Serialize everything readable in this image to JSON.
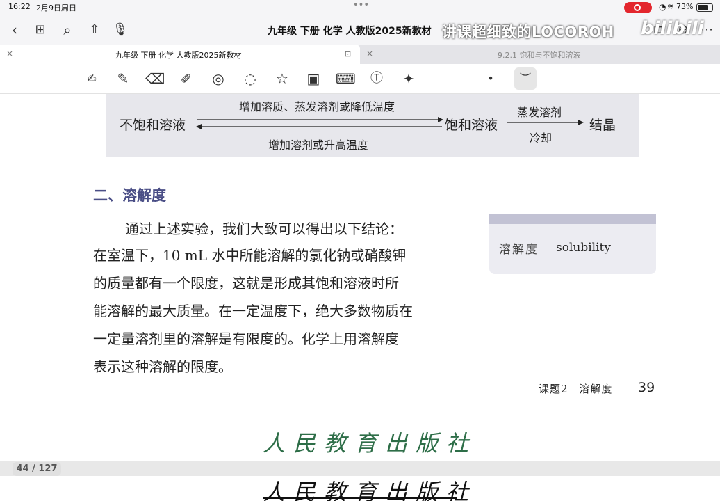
{
  "status_bar": {
    "time": "16:22",
    "date": "2月9日周日",
    "battery": "73%",
    "battery_level": 0.73
  },
  "nav": {
    "document_title": "九年级 下册 化学 人教版2025新教材"
  },
  "overlay": {
    "watermark": "讲课超细致的LOCOROH",
    "logo": "bilibili"
  },
  "tabs": [
    {
      "label": "九年级 下册 化学 人教版2025新教材",
      "active": true
    },
    {
      "label": "9.2.1 饱和与不饱和溶液",
      "active": false
    }
  ],
  "toolbar": {
    "tools": [
      "lasso-ocr",
      "pen",
      "eraser",
      "highlighter",
      "shapes",
      "lasso",
      "sticker",
      "image",
      "keyboard",
      "text",
      "laser-pointer"
    ],
    "stroke_dot": "•",
    "pen_preview": "︶"
  },
  "diagram": {
    "left_state": "不饱和溶液",
    "top_condition": "增加溶质、蒸发溶剂或降低温度",
    "bottom_condition": "增加溶剂或升高温度",
    "middle_state": "饱和溶液",
    "evap_label": "蒸发溶剂",
    "cool_label": "冷却",
    "end_state": "结晶"
  },
  "section": {
    "title": "二、溶解度"
  },
  "paragraph_lines": [
    "通过上述实验，我们大致可以得出以下结论：",
    "在室温下，10 mL 水中所能溶解的氯化钠或硝酸钾",
    "的质量都有一个限度，这就是形成其饱和溶液时所",
    "能溶解的最大质量。在一定温度下，绝大多数物质在",
    "一定量溶剂里的溶解是有限度的。化学上用溶解度",
    "表示这种溶解的限度。"
  ],
  "vocab": {
    "term_cn": "溶解度",
    "term_en": "solubility"
  },
  "footer": {
    "text": "课题2　溶解度",
    "page_number": "39"
  },
  "publisher": "人民教育出版社",
  "page_counter": "44 / 127"
}
